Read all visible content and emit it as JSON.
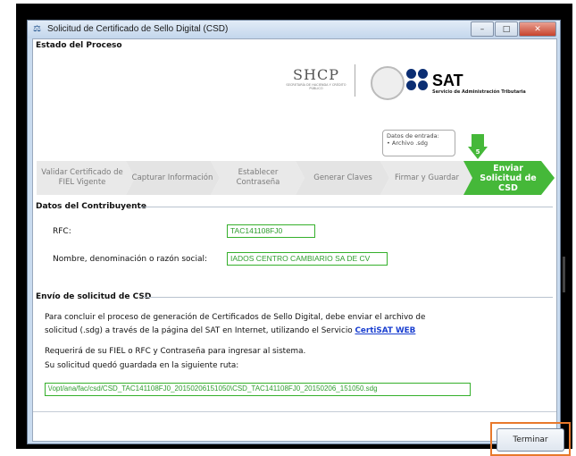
{
  "window": {
    "title": "Solicitud de Certificado de Sello Digital (CSD)",
    "minimize_symbol": "–",
    "maximize_symbol": "□",
    "close_symbol": "✕"
  },
  "process": {
    "section_title": "Estado del Proceso",
    "shcp_logo": "SHCP",
    "shcp_subtitle": "SECRETARÍA DE HACIENDA Y CRÉDITO PÚBLICO",
    "sat_logo": "SAT",
    "sat_subtitle": "Servicio de Administración Tributaria",
    "input_box_title": "Datos de entrada:",
    "input_box_item": "• Archivo .sdg",
    "current_step_number": "5",
    "steps": [
      {
        "label": "Validar Certificado de FIEL Vigente"
      },
      {
        "label": "Capturar Información"
      },
      {
        "label": "Establecer Contraseña"
      },
      {
        "label": "Generar Claves"
      },
      {
        "label": "Firmar y Guardar"
      },
      {
        "label": "Enviar Solicitud de CSD"
      }
    ],
    "active_step": 5,
    "colors": {
      "active": "#45b839",
      "inactive": "#e4e4e4"
    }
  },
  "contribuyente": {
    "section_title": "Datos del Contribuyente",
    "rfc_label": "RFC:",
    "rfc_value": "TAC141108FJ0",
    "name_label": "Nombre, denominación o razón social:",
    "name_value": "IADOS CENTRO CAMBIARIO SA DE CV"
  },
  "envio": {
    "section_title": "Envío de solicitud de CSD",
    "para1_line1": "Para concluir el proceso de generación de Certificados de Sello Digital, debe enviar el archivo de",
    "para1_line2": "solicitud (.sdg) a través de la página del SAT en Internet, utilizando el Servicio",
    "link_text": "CertiSAT WEB",
    "para2": "Requerirá de su FIEL o RFC y Contraseña para ingresar al sistema.",
    "para3": "Su solicitud quedó guardada en la siguiente ruta:",
    "path_value": "\\/opt/ana/fac/csd/CSD_TAC141108FJ0_20150206151050\\CSD_TAC141108FJ0_20150206_151050.sdg"
  },
  "footer": {
    "terminar_label": "Terminar",
    "highlight_color": "#e8792c"
  }
}
